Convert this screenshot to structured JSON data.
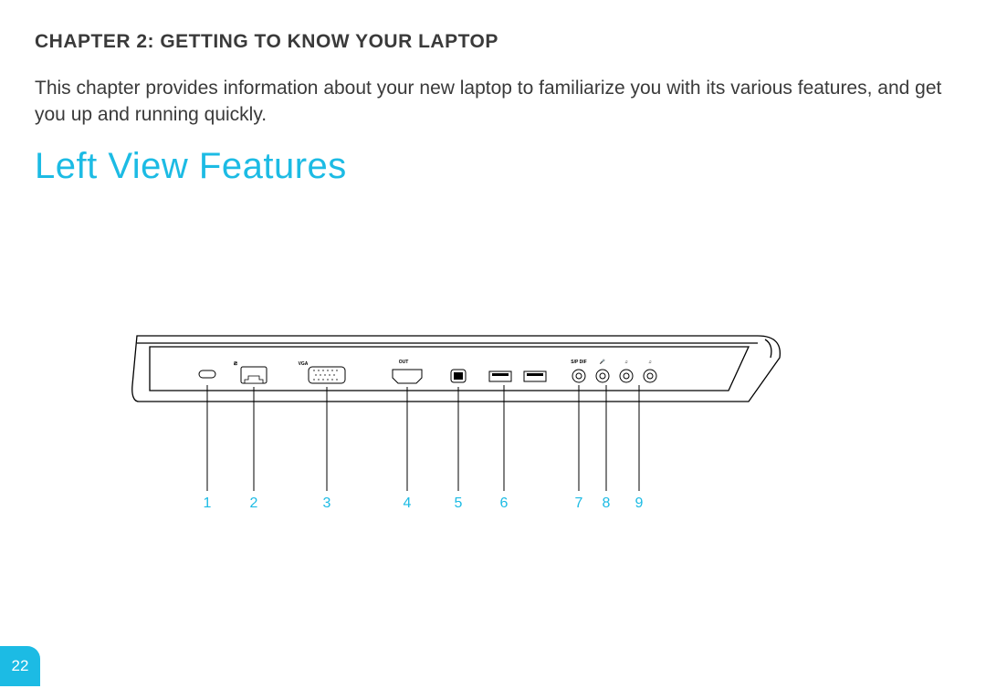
{
  "chapter_header": "CHAPTER 2: GETTING TO KNOW YOUR LAPTOP",
  "intro_text": "This chapter provides information about your new laptop to familiarize you with its various features, and get you up and running quickly.",
  "section_title": "Left View Features",
  "page_number": "22",
  "diagram": {
    "port_labels": {
      "vga": "VGA",
      "hdmi_out": "OUT",
      "spdif": "S/P DIF"
    },
    "callouts": [
      "1",
      "2",
      "3",
      "4",
      "5",
      "6",
      "7",
      "8",
      "9"
    ]
  }
}
